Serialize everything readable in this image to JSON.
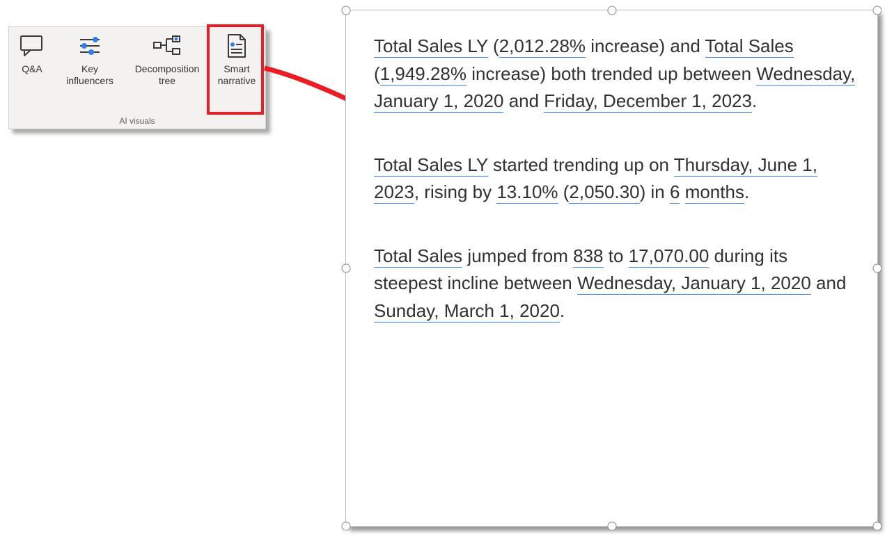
{
  "ribbon": {
    "group_label": "AI visuals",
    "buttons": {
      "qna": {
        "label": "Q&A"
      },
      "key": {
        "label1": "Key",
        "label2": "influencers"
      },
      "tree": {
        "label1": "Decomposition",
        "label2": "tree"
      },
      "smart": {
        "label1": "Smart",
        "label2": "narrative"
      }
    }
  },
  "narrative": {
    "p1": {
      "v1": "Total Sales LY",
      "v2": "2,012.28%",
      "t1": " (",
      "t1b": " increase) and ",
      "v3": "Total Sales",
      "v4": "1,949.28%",
      "t2": " (",
      "t2b": " increase) both trended up between ",
      "v5": "Wednesday, January 1, 2020",
      "t3": " and ",
      "v6": "Friday, December 1, 2023",
      "t4": "."
    },
    "p2": {
      "v1": "Total Sales LY",
      "t1": " started trending up on ",
      "v2": "Thursday, June 1, 2023",
      "t2": ", rising by ",
      "v3": "13.10%",
      "t3": " (",
      "v4": "2,050.30",
      "t4": ") in ",
      "v5": "6",
      "v6": "months",
      "t5": "."
    },
    "p3": {
      "v1": "Total Sales",
      "t1": " jumped from ",
      "v2": "838",
      "t2": " to ",
      "v3": "17,070.00",
      "t3": " during its steepest incline between ",
      "v4": "Wednesday, January 1, 2020",
      "t4": " and ",
      "v5": "Sunday, March 1, 2020",
      "t5": "."
    }
  }
}
